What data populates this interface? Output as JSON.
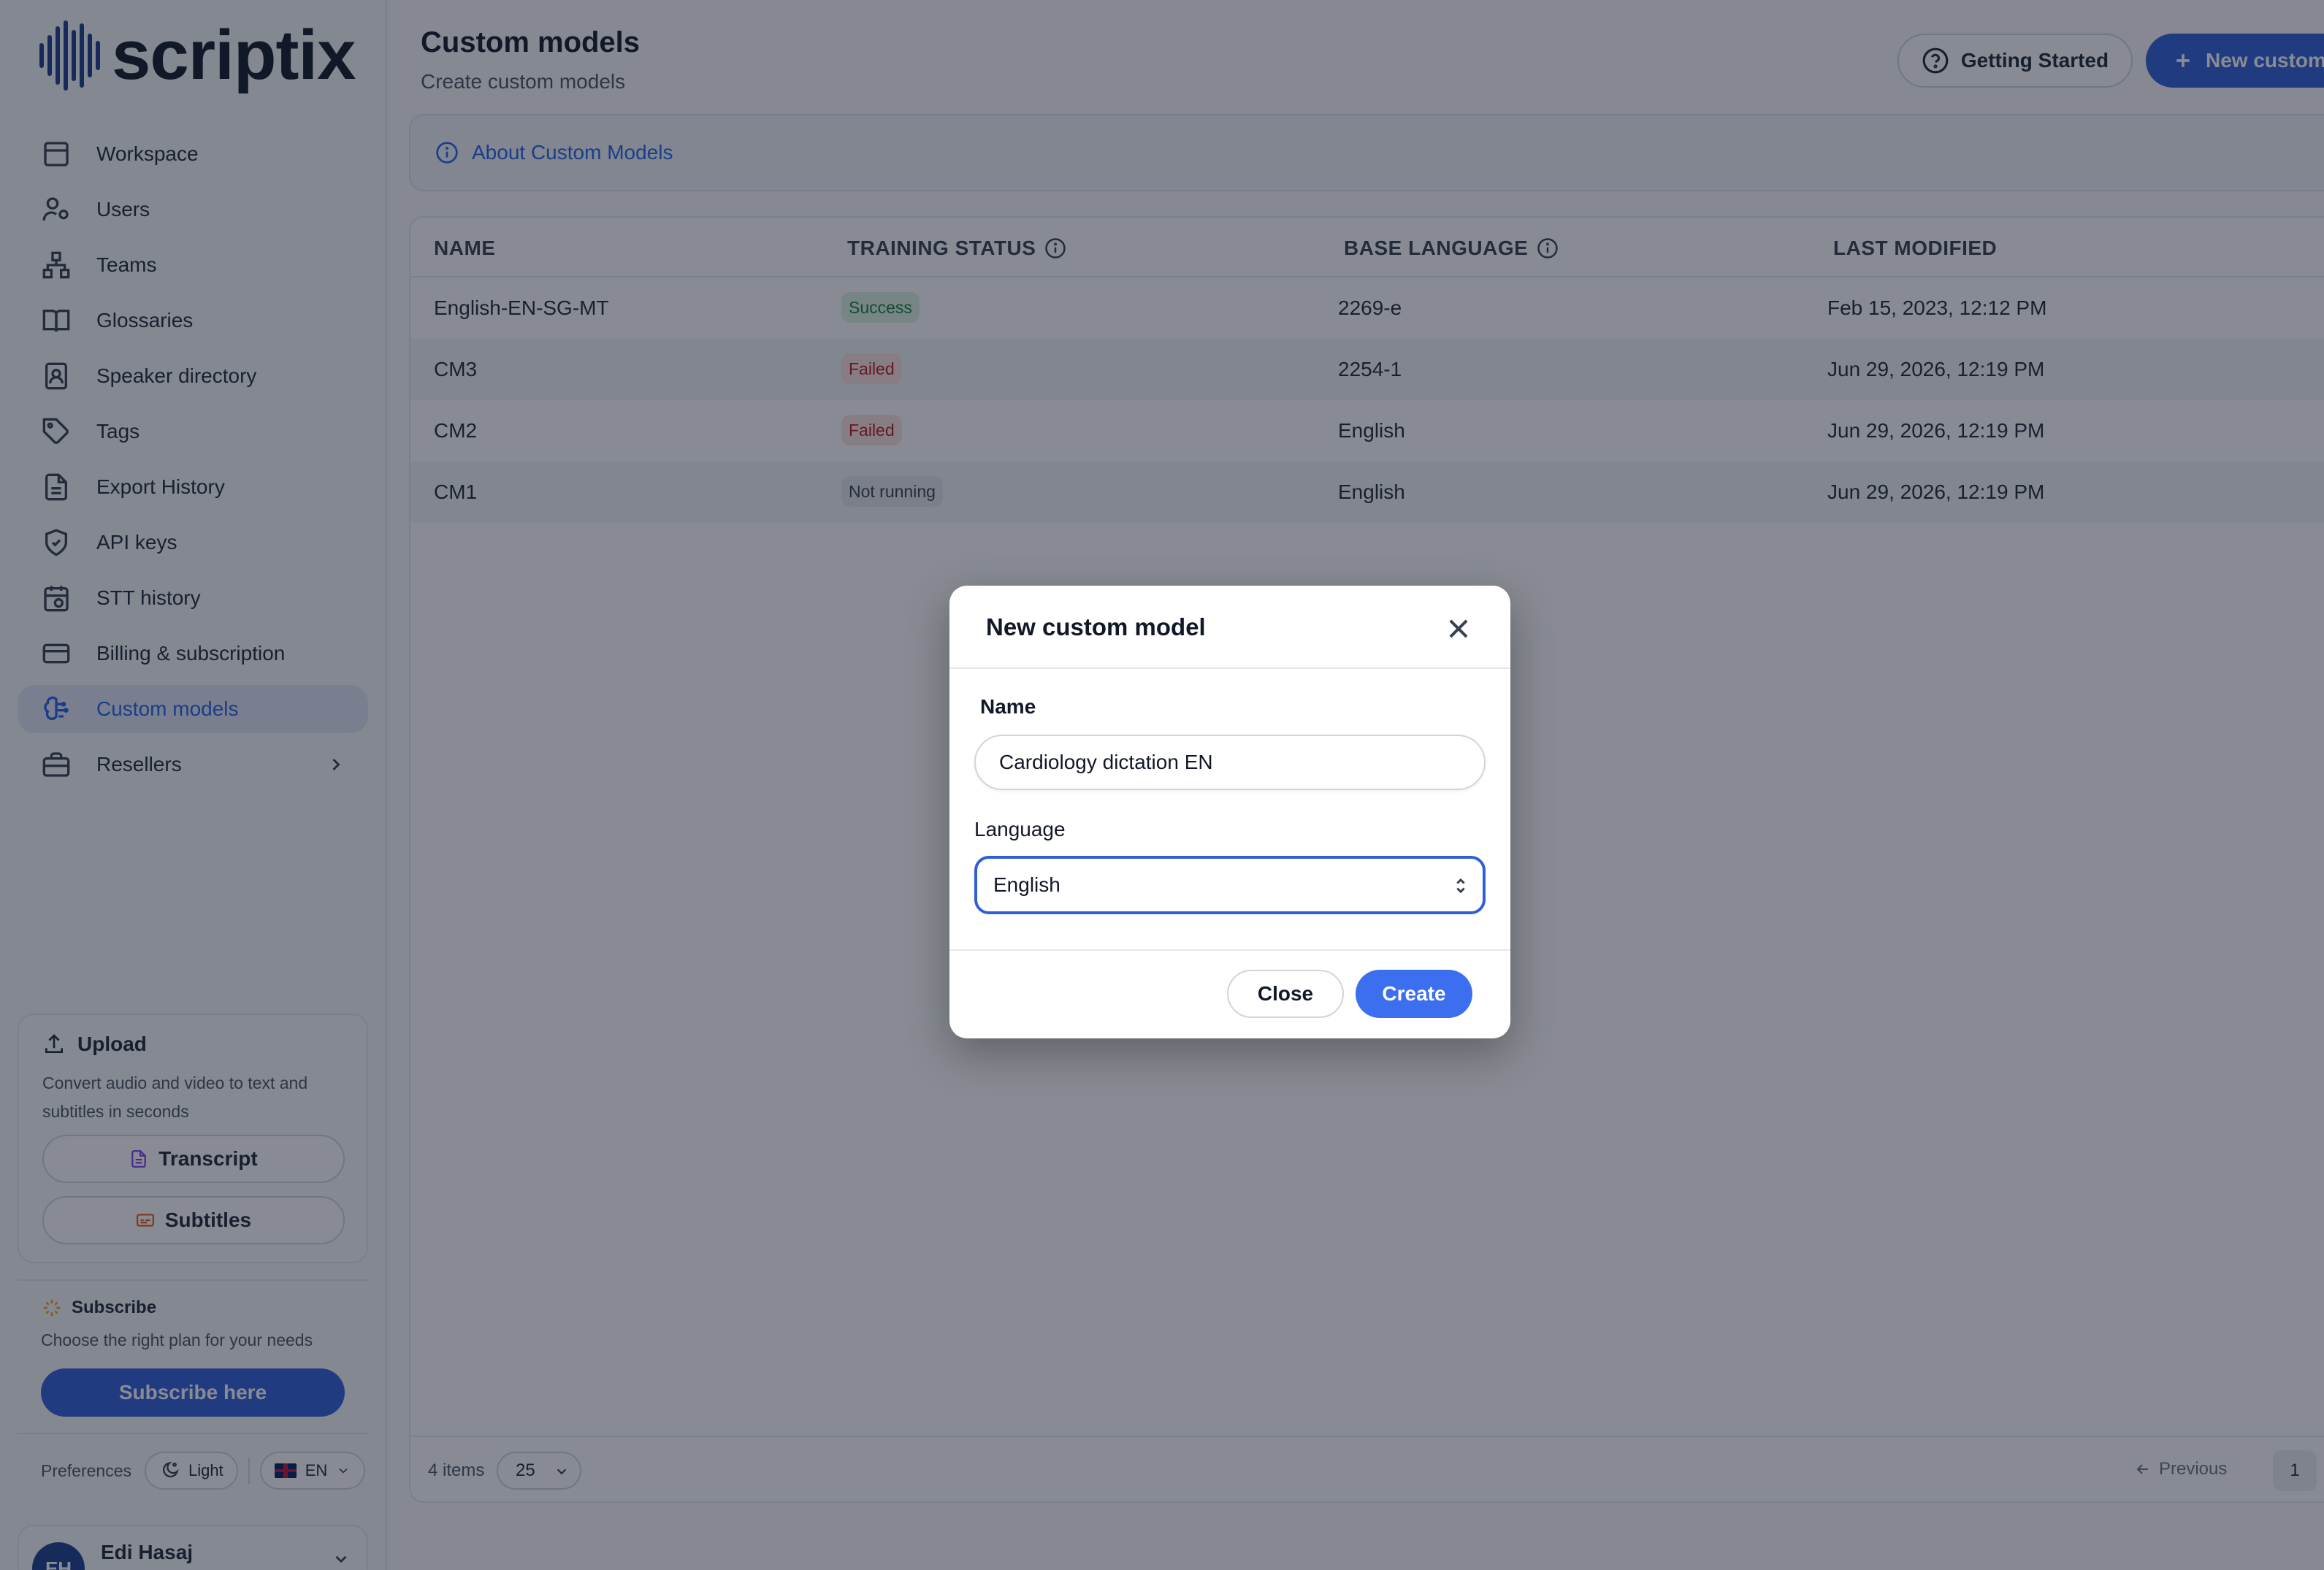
{
  "brand": {
    "name": "scriptix"
  },
  "sidebar": {
    "items": [
      {
        "label": "Workspace",
        "icon": "workspace-icon"
      },
      {
        "label": "Users",
        "icon": "users-icon"
      },
      {
        "label": "Teams",
        "icon": "teams-icon"
      },
      {
        "label": "Glossaries",
        "icon": "book-icon"
      },
      {
        "label": "Speaker directory",
        "icon": "contact-icon"
      },
      {
        "label": "Tags",
        "icon": "tag-icon"
      },
      {
        "label": "Export History",
        "icon": "document-icon"
      },
      {
        "label": "API keys",
        "icon": "shield-icon"
      },
      {
        "label": "STT history",
        "icon": "calendar-clock-icon"
      },
      {
        "label": "Billing & subscription",
        "icon": "credit-card-icon"
      },
      {
        "label": "Custom models",
        "icon": "brain-icon",
        "active": true
      },
      {
        "label": "Resellers",
        "icon": "briefcase-icon"
      }
    ],
    "upload": {
      "title": "Upload",
      "description": "Convert audio and video to text and subtitles in seconds",
      "transcript_label": "Transcript",
      "subtitles_label": "Subtitles"
    },
    "subscribe": {
      "title": "Subscribe",
      "description": "Choose the right plan for your needs",
      "button_label": "Subscribe here"
    },
    "preferences": {
      "label": "Preferences",
      "theme_label": "Light",
      "language_label": "EN"
    },
    "user": {
      "initials": "EH",
      "name": "Edi Hasaj"
    }
  },
  "header": {
    "title": "Custom models",
    "subtitle": "Create custom models",
    "getting_started_label": "Getting Started",
    "new_button_label": "New custom model"
  },
  "about_link": "About Custom Models",
  "table": {
    "columns": [
      "NAME",
      "TRAINING STATUS",
      "BASE LANGUAGE",
      "LAST MODIFIED"
    ],
    "rows": [
      {
        "name": "English-EN-SG-MT",
        "status": "Success",
        "language": "2269-e",
        "modified": "Feb 15, 2023, 12:12 PM"
      },
      {
        "name": "CM3",
        "status": "Failed",
        "language": "2254-1",
        "modified": "Jun 29, 2026, 12:19 PM"
      },
      {
        "name": "CM2",
        "status": "Failed",
        "language": "English",
        "modified": "Jun 29, 2026, 12:19 PM"
      },
      {
        "name": "CM1",
        "status": "Not running",
        "language": "English",
        "modified": "Jun 29, 2026, 12:19 PM"
      }
    ],
    "footer": {
      "items_count": "4 items",
      "per_page": "25",
      "previous_label": "Previous",
      "current_page": "1"
    }
  },
  "modal": {
    "title": "New custom model",
    "name_label": "Name",
    "name_value": "Cardiology dictation EN",
    "language_label": "Language",
    "language_value": "English",
    "close_label": "Close",
    "create_label": "Create"
  },
  "colors": {
    "accent": "#2f5fd6",
    "success_bg": "#dcf5e3",
    "failed_bg": "#fde2e2",
    "overlay": "rgba(17,24,39,0.5)"
  }
}
